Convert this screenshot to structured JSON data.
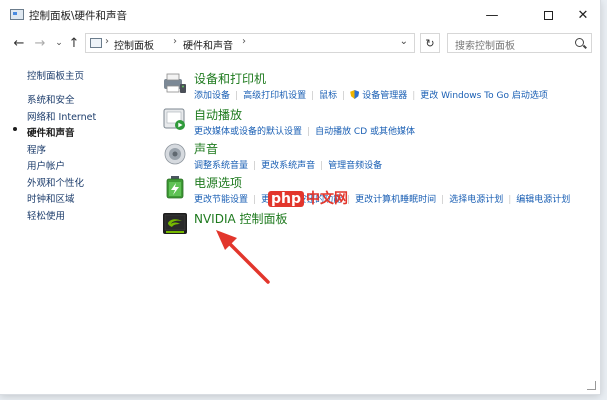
{
  "window": {
    "title": "控制面板\\硬件和声音",
    "minimize": "—",
    "close": "✕"
  },
  "nav": {
    "back": "←",
    "forward": "→",
    "history": "⌄",
    "up": "↑",
    "breadcrumbs": [
      "控制面板",
      "硬件和声音"
    ],
    "crumb_separator": "›",
    "address_dropdown": "⌄",
    "refresh": "↻",
    "search_placeholder": "搜索控制面板"
  },
  "sidebar": {
    "items": [
      {
        "label": "控制面板主页",
        "current": false
      },
      {
        "label": "系统和安全",
        "current": false
      },
      {
        "label": "网络和 Internet",
        "current": false
      },
      {
        "label": "硬件和声音",
        "current": true
      },
      {
        "label": "程序",
        "current": false
      },
      {
        "label": "用户帐户",
        "current": false
      },
      {
        "label": "外观和个性化",
        "current": false
      },
      {
        "label": "时钟和区域",
        "current": false
      },
      {
        "label": "轻松使用",
        "current": false
      }
    ]
  },
  "categories": [
    {
      "title": "设备和打印机",
      "icon": "printer-icon",
      "links": [
        "添加设备",
        "高级打印机设置",
        "鼠标",
        "设备管理器",
        "更改 Windows To Go 启动选项"
      ]
    },
    {
      "title": "自动播放",
      "icon": "autoplay-icon",
      "links": [
        "更改媒体或设备的默认设置",
        "自动播放 CD 或其他媒体"
      ]
    },
    {
      "title": "声音",
      "icon": "speaker-icon",
      "links": [
        "调整系统音量",
        "更改系统声音",
        "管理音频设备"
      ]
    },
    {
      "title": "电源选项",
      "icon": "battery-icon",
      "links": [
        "更改节能设置",
        "更改电源按钮的功能",
        "更改计算机睡眠时间",
        "选择电源计划",
        "编辑电源计划"
      ]
    },
    {
      "title": "NVIDIA 控制面板",
      "icon": "nvidia-icon",
      "links": []
    }
  ],
  "watermark": {
    "part1": "php",
    "part2": "中文网"
  },
  "colors": {
    "link": "#1a5fb4",
    "category_title": "#1e7a1e",
    "arrow": "#e2362c"
  }
}
